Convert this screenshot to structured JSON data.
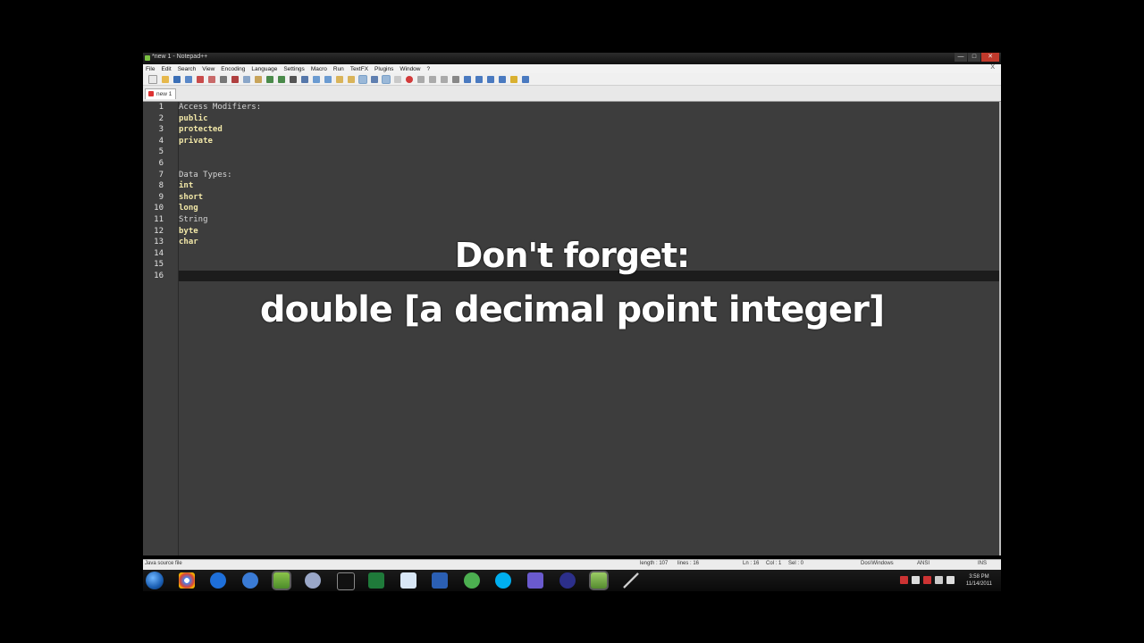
{
  "window": {
    "title": "*new  1 - Notepad++",
    "buttons": {
      "minimize": "—",
      "maximize": "□",
      "close": "✕"
    }
  },
  "menu": {
    "items": [
      "File",
      "Edit",
      "Search",
      "View",
      "Encoding",
      "Language",
      "Settings",
      "Macro",
      "Run",
      "TextFX",
      "Plugins",
      "Window",
      "?"
    ],
    "close_label": "X"
  },
  "tab": {
    "label": "new  1"
  },
  "editor": {
    "line_numbers": [
      "1",
      "2",
      "3",
      "4",
      "5",
      "6",
      "7",
      "8",
      "9",
      "10",
      "11",
      "12",
      "13",
      "14",
      "15",
      "16"
    ],
    "lines": [
      {
        "text": "Access Modifiers:",
        "style": "plain"
      },
      {
        "text": "public",
        "style": "kw"
      },
      {
        "text": "protected",
        "style": "kw"
      },
      {
        "text": "private",
        "style": "kw"
      },
      {
        "text": "",
        "style": "plain"
      },
      {
        "text": "",
        "style": "plain"
      },
      {
        "text": "Data Types:",
        "style": "plain"
      },
      {
        "text": "int",
        "style": "kw"
      },
      {
        "text": "short",
        "style": "kw"
      },
      {
        "text": "long",
        "style": "kw"
      },
      {
        "text": "String",
        "style": "plain"
      },
      {
        "text": "byte",
        "style": "kw"
      },
      {
        "text": "char",
        "style": "kw"
      },
      {
        "text": "",
        "style": "plain"
      },
      {
        "text": "",
        "style": "plain"
      },
      {
        "text": "",
        "style": "plain"
      }
    ],
    "current_line": 16
  },
  "overlay": {
    "line1": "Don't forget:",
    "line2": "double  [a decimal point integer]"
  },
  "statusbar": {
    "file_type": "Java source file",
    "length": "length : 107",
    "lines": "lines : 16",
    "position": "Ln : 16",
    "col": "Col : 1",
    "sel": "Sel : 0",
    "eol": "Dos\\Windows",
    "encoding": "ANSI",
    "mode": "INS"
  },
  "taskbar": {
    "icons": [
      "windows-start",
      "chrome",
      "internet-explorer",
      "itunes",
      "notepad-plus-plus",
      "eclipse-ide",
      "command-prompt",
      "excel",
      "notepad",
      "word",
      "messenger",
      "skype",
      "wamp",
      "eclipse",
      "notepad-plus-plus-2",
      "pen-tool"
    ],
    "clock_time": "3:58 PM",
    "clock_date": "11/14/2011"
  },
  "colors": {
    "editor_bg": "#3d3d3d",
    "keyword": "#f2e8a8",
    "plain_text": "#d6d6d6",
    "current_line": "#1c1c1c"
  }
}
